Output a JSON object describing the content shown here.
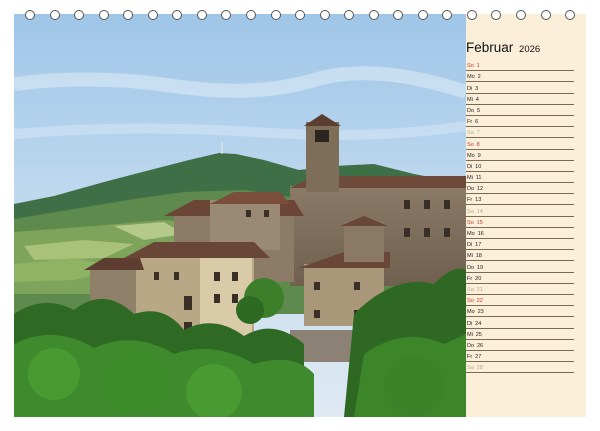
{
  "calendar": {
    "month": "Februar",
    "year": "2026",
    "days": [
      {
        "label": "So",
        "num": "1",
        "type": "sun"
      },
      {
        "label": "Mo",
        "num": "2",
        "type": "wd"
      },
      {
        "label": "Di",
        "num": "3",
        "type": "wd"
      },
      {
        "label": "Mi",
        "num": "4",
        "type": "wd"
      },
      {
        "label": "Do",
        "num": "5",
        "type": "wd"
      },
      {
        "label": "Fr",
        "num": "6",
        "type": "wd"
      },
      {
        "label": "Sa",
        "num": "7",
        "type": "sat"
      },
      {
        "label": "So",
        "num": "8",
        "type": "sun"
      },
      {
        "label": "Mo",
        "num": "9",
        "type": "wd"
      },
      {
        "label": "Di",
        "num": "10",
        "type": "wd"
      },
      {
        "label": "Mi",
        "num": "11",
        "type": "wd"
      },
      {
        "label": "Do",
        "num": "12",
        "type": "wd"
      },
      {
        "label": "Fr",
        "num": "13",
        "type": "wd"
      },
      {
        "label": "Sa",
        "num": "14",
        "type": "sat"
      },
      {
        "label": "So",
        "num": "15",
        "type": "sun"
      },
      {
        "label": "Mo",
        "num": "16",
        "type": "wd"
      },
      {
        "label": "Di",
        "num": "17",
        "type": "wd"
      },
      {
        "label": "Mi",
        "num": "18",
        "type": "wd"
      },
      {
        "label": "Do",
        "num": "19",
        "type": "wd"
      },
      {
        "label": "Fr",
        "num": "20",
        "type": "wd"
      },
      {
        "label": "Sa",
        "num": "21",
        "type": "sat"
      },
      {
        "label": "So",
        "num": "22",
        "type": "sun"
      },
      {
        "label": "Mo",
        "num": "23",
        "type": "wd"
      },
      {
        "label": "Di",
        "num": "24",
        "type": "wd"
      },
      {
        "label": "Mi",
        "num": "25",
        "type": "wd"
      },
      {
        "label": "Do",
        "num": "26",
        "type": "wd"
      },
      {
        "label": "Fr",
        "num": "27",
        "type": "wd"
      },
      {
        "label": "Sa",
        "num": "28",
        "type": "sat"
      }
    ]
  },
  "colors": {
    "sunday": "#c0392b",
    "saturday": "#b8a98f",
    "weekday": "#222222",
    "panel": "#fcefd9"
  },
  "ring_count": 23
}
